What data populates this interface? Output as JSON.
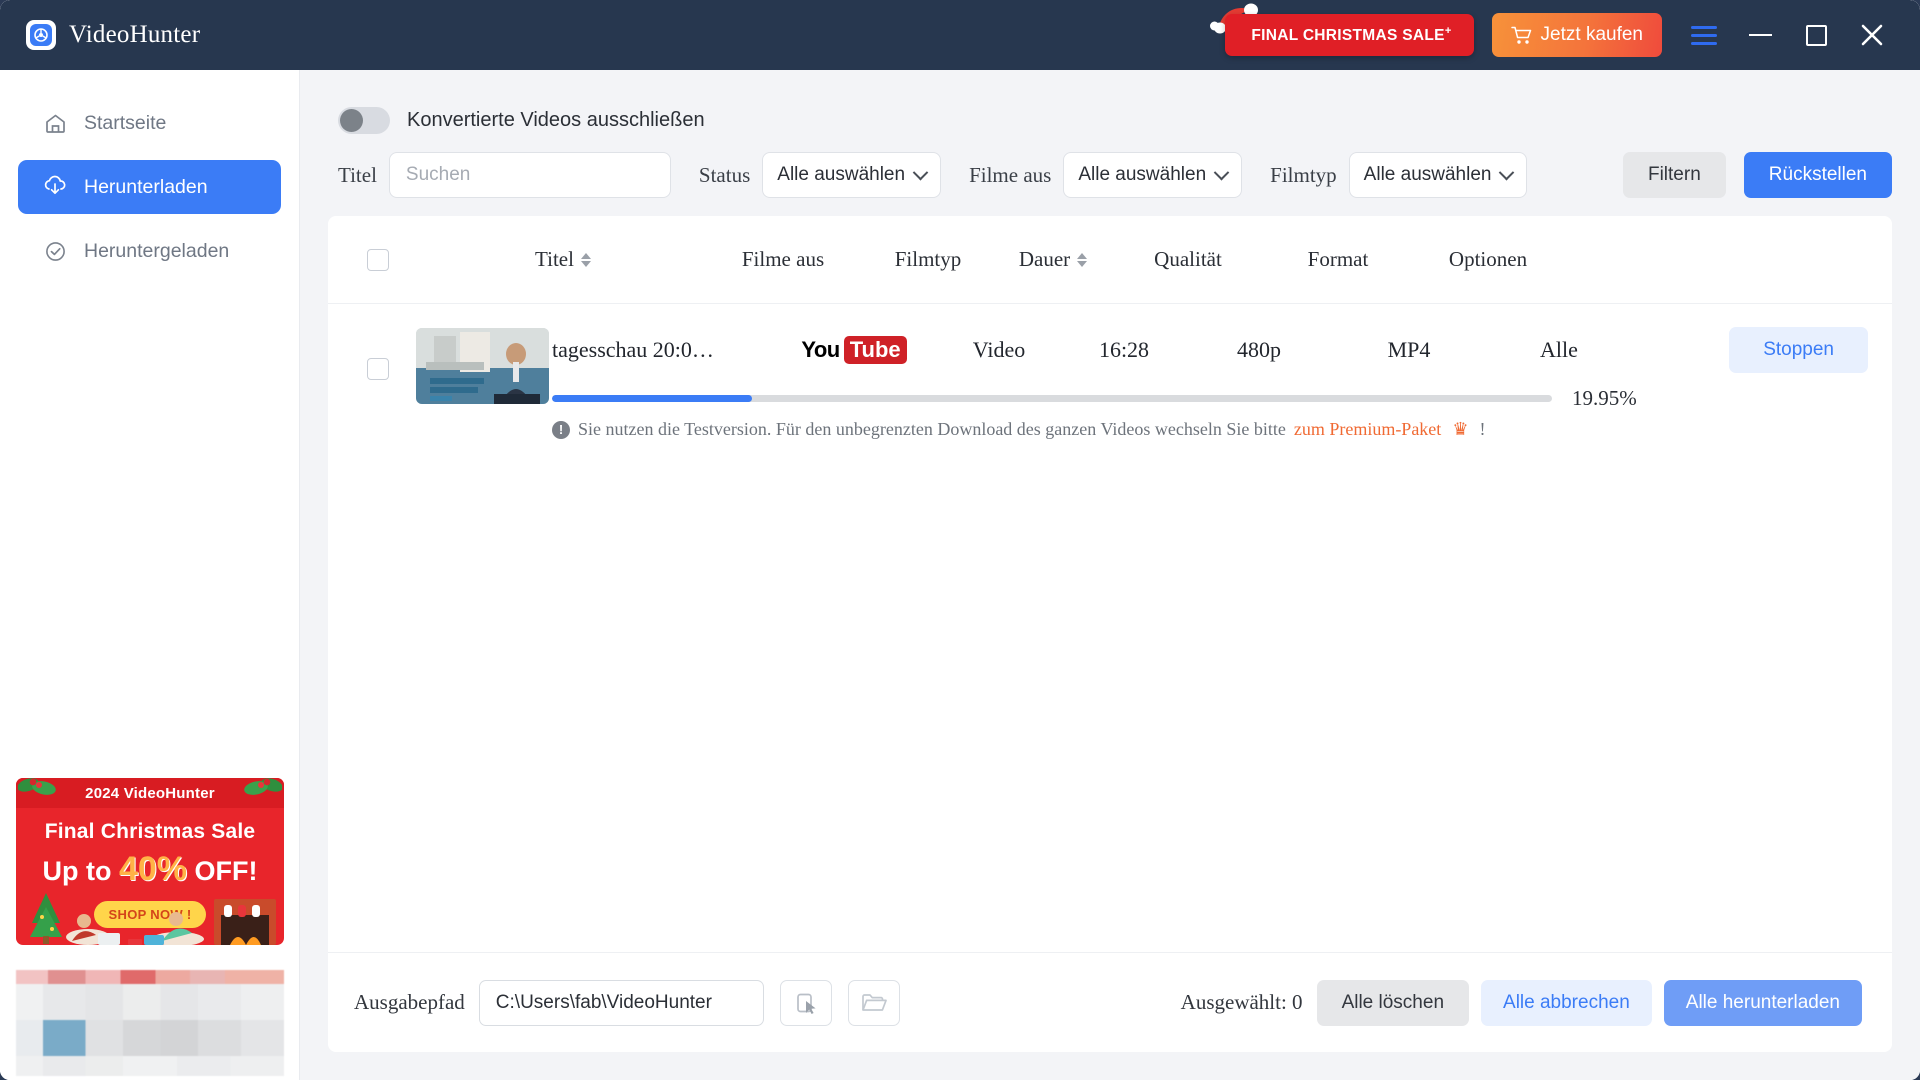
{
  "window": {
    "app_title": "VideoHunter",
    "logo_icon": "videohunter-logo-icon",
    "promo_badge": "FINAL CHRISTMAS SALE",
    "promo_badge_sup": "+",
    "buy_button": "Jetzt kaufen",
    "cart_icon": "cart-icon",
    "menu_icon": "hamburger-menu-icon",
    "minimize_icon": "minimize-icon",
    "maximize_icon": "maximize-icon",
    "close_icon": "close-icon",
    "titlebar_bg": "#27374f",
    "accent_blue": "#3b7cf6",
    "accent_orange": "#f4743b",
    "accent_red": "#e01f26"
  },
  "sidebar": {
    "items": [
      {
        "label": "Startseite",
        "icon": "home-icon",
        "active": false
      },
      {
        "label": "Herunterladen",
        "icon": "download-cloud-icon",
        "active": true
      },
      {
        "label": "Heruntergeladen",
        "icon": "check-circle-icon",
        "active": false
      }
    ],
    "promo": {
      "year_title": "2024 VideoHunter",
      "line1": "Final Christmas Sale",
      "line2_pre": "Up to ",
      "line2_pct": "40%",
      "line2_post": " OFF!",
      "cta": "SHOP NOW !",
      "bg": "#e8252b"
    }
  },
  "main": {
    "toggle": {
      "label": "Konvertierte Videos ausschließen",
      "on": false
    },
    "filters": {
      "title_label": "Titel",
      "search_placeholder": "Suchen",
      "search_value": "",
      "status_label": "Status",
      "status_value": "Alle auswählen",
      "from_label": "Filme aus",
      "from_value": "Alle auswählen",
      "type_label": "Filmtyp",
      "type_value": "Alle auswählen",
      "filter_button": "Filtern",
      "reset_button": "Rückstellen"
    },
    "table": {
      "headers": {
        "title": "Titel",
        "from": "Filme aus",
        "type": "Filmtyp",
        "duration": "Dauer",
        "quality": "Qualität",
        "format": "Format",
        "options": "Optionen"
      },
      "sortable": [
        "Titel",
        "Dauer"
      ],
      "rows": [
        {
          "checked": false,
          "title": "tagesschau 20:0…",
          "source": "YouTube",
          "source_logo_you": "You",
          "source_logo_tube": "Tube",
          "type": "Video",
          "duration": "16:28",
          "quality": "480p",
          "format": "MP4",
          "options": "Alle",
          "action_button": "Stoppen",
          "progress_percent": "19.95%",
          "progress_value": 19.95,
          "notice_prefix": "Sie nutzen die Testversion. Für den unbegrenzten Download des ganzen Videos wechseln Sie bitte",
          "notice_link": "zum Premium-Paket",
          "notice_crown": "♛",
          "notice_suffix": "!"
        }
      ]
    },
    "footer": {
      "output_label": "Ausgabepfad",
      "output_path": "C:\\Users\\fab\\VideoHunter",
      "pick_icon": "cursor-select-icon",
      "folder_icon": "open-folder-icon",
      "selected_label": "Ausgewählt: 0",
      "delete_all": "Alle löschen",
      "cancel_all": "Alle abbrechen",
      "download_all": "Alle herunterladen"
    }
  }
}
